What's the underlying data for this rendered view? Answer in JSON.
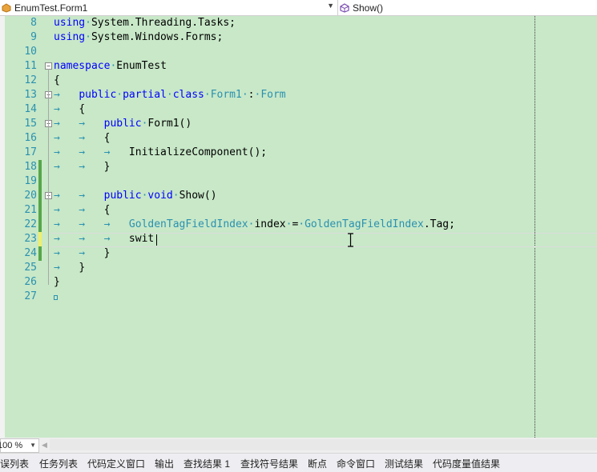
{
  "navigation": {
    "class_combo": "EnumTest.Form1",
    "member_combo": "Show()"
  },
  "editor": {
    "lines": [
      {
        "number": "8",
        "text": "using System.Threading.Tasks;",
        "change": "none"
      },
      {
        "number": "9",
        "text": "using System.Windows.Forms;",
        "change": "none"
      },
      {
        "number": "10",
        "text": "",
        "change": "none"
      },
      {
        "number": "11",
        "text": "namespace EnumTest",
        "change": "none"
      },
      {
        "number": "12",
        "text": "{",
        "change": "none"
      },
      {
        "number": "13",
        "text": "public partial class Form1 : Form",
        "change": "none"
      },
      {
        "number": "14",
        "text": "{",
        "change": "none"
      },
      {
        "number": "15",
        "text": "public Form1()",
        "change": "none"
      },
      {
        "number": "16",
        "text": "{",
        "change": "none"
      },
      {
        "number": "17",
        "text": "InitializeComponent();",
        "change": "none"
      },
      {
        "number": "18",
        "text": "}",
        "change": "saved"
      },
      {
        "number": "19",
        "text": "",
        "change": "saved"
      },
      {
        "number": "20",
        "text": "public void Show()",
        "change": "saved"
      },
      {
        "number": "21",
        "text": "{",
        "change": "saved"
      },
      {
        "number": "22",
        "text": "GoldenTagFieldIndex index = GoldenTagFieldIndex.Tag;",
        "change": "saved"
      },
      {
        "number": "23",
        "text": "swit",
        "change": "unsaved"
      },
      {
        "number": "24",
        "text": "}",
        "change": "saved"
      },
      {
        "number": "25",
        "text": "}",
        "change": "none"
      },
      {
        "number": "26",
        "text": "}",
        "change": "none"
      },
      {
        "number": "27",
        "text": "",
        "change": "none"
      }
    ],
    "colors": {
      "background": "#c8e8c8",
      "keyword": "#0000ff",
      "type": "#2b91af",
      "line_number": "#2b91af",
      "saved_change": "#57a64a",
      "unsaved_change": "#efef66"
    }
  },
  "zoom": {
    "value": "100 %"
  },
  "tool_tabs": [
    "错误列表",
    "任务列表",
    "代码定义窗口",
    "输出",
    "查找结果 1",
    "查找符号结果",
    "断点",
    "命令窗口",
    "测试结果",
    "代码度量值结果"
  ]
}
